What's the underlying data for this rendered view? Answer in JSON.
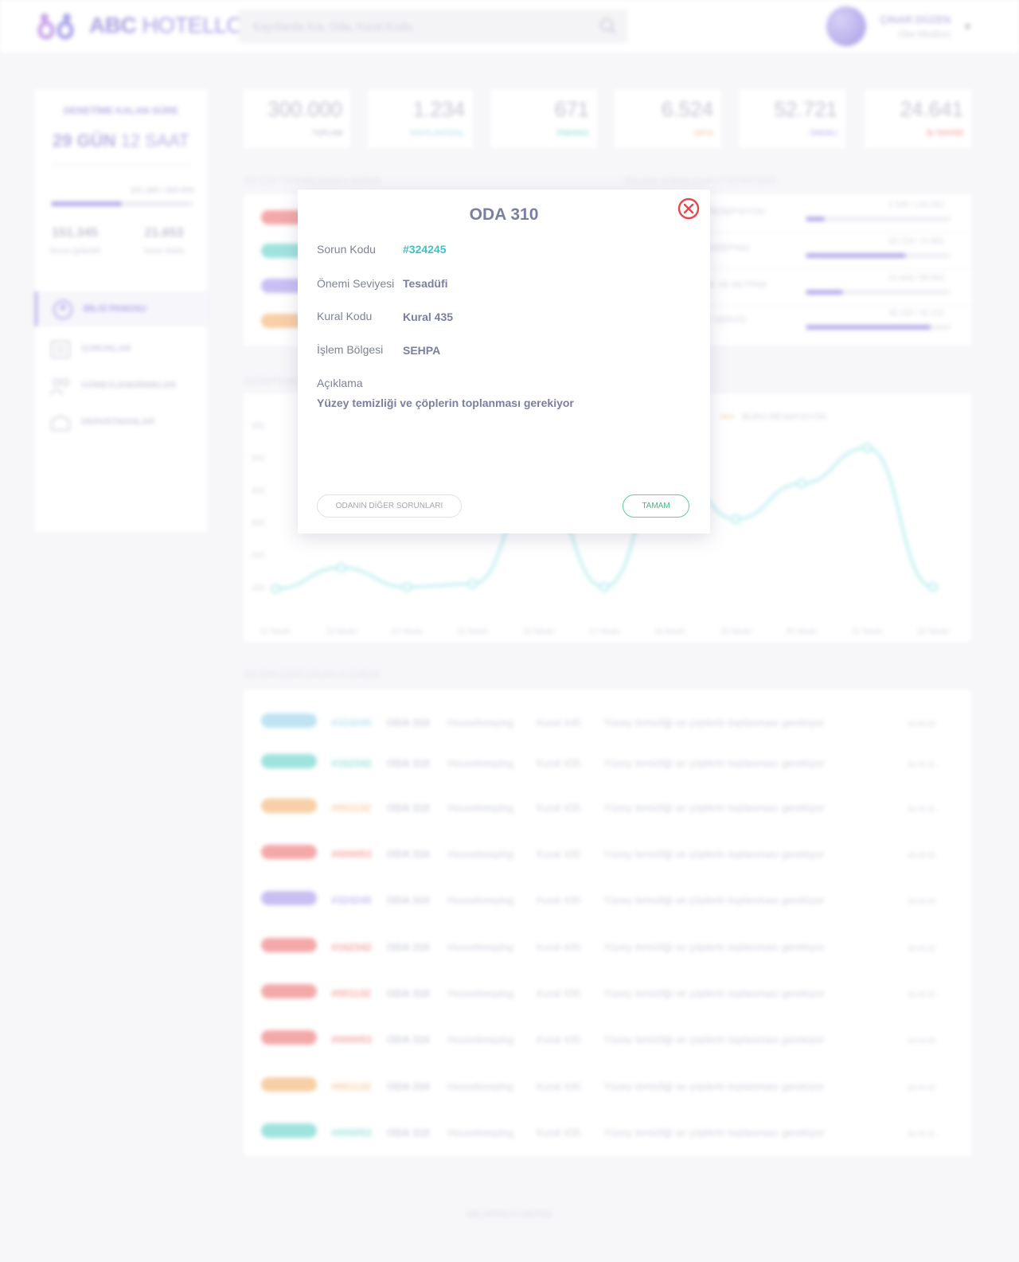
{
  "app": {
    "logo_text_bold": "ABC",
    "logo_text_light": " HOTELLO",
    "search_placeholder": "Kayıtlarda Ara, Oda, Kural Kodu",
    "user_name": "ÇINAR DÜZEN",
    "user_role": "Otel Müdürü"
  },
  "sidebar": {
    "audit_title": "DENETİME KALAN SÜRE",
    "audit_days": "29 GÜN",
    "audit_hours": " 12 SAAT",
    "progress_ratio": "151.345 / 300.000",
    "progress_fraction": 0.5,
    "stats": [
      {
        "value": "151.345",
        "label": "Sorun giderildi"
      },
      {
        "value": "21.653",
        "label": "Günü doldu"
      }
    ],
    "nav": [
      {
        "label": "BİLGİ PANOSU",
        "active": true,
        "icon": "dashboard-icon"
      },
      {
        "label": "SORUNLAR",
        "active": false,
        "icon": "issues-icon"
      },
      {
        "label": "GÖREVLENDİRMELER",
        "active": false,
        "icon": "assignments-icon"
      },
      {
        "label": "DEPARTMANLAR",
        "active": false,
        "icon": "departments-icon"
      }
    ]
  },
  "stat_cards": [
    {
      "value": "300.000",
      "label": "TOPLAM",
      "color": "#c9c9d6"
    },
    {
      "value": "1.234",
      "label": "RASTLANTISAL",
      "color": "#bfe3f2"
    },
    {
      "value": "671",
      "label": "ÖNEMSİZ",
      "color": "#9fe3de"
    },
    {
      "value": "6.524",
      "label": "ORTA",
      "color": "#f8cfa6"
    },
    {
      "value": "52.721",
      "label": "ÖNEMLİ",
      "color": "#c9bff2"
    },
    {
      "value": "24.641",
      "label": "İŞ TEHTİDİ",
      "color": "#f4a9a9"
    }
  ],
  "sections": {
    "top_left_title": "EN ÇOK TEKRARLANAN 5 SORUN",
    "top_right_title": "EN ÇOK SORUN OLAN 4 DEPARTMAN",
    "chart_title": "DEPARTMAN",
    "issues_title": "EN SON GÜNÜ DOLAN 10 SORUN"
  },
  "top_issue_chips": [
    "#f4a9a9",
    "#9fe3de",
    "#c9bff2",
    "#f8cfa6"
  ],
  "departments": [
    {
      "name": "BÜRO RESEPSİYON",
      "ratio": "1.345 / 133.562",
      "fraction": 0.13
    },
    {
      "name": "HOUSEKEEPING",
      "ratio": "53.724 / 74.952",
      "fraction": 0.69
    },
    {
      "name": "MUTFAK VE MUTFAK",
      "ratio": "21.643 / 50.562",
      "fraction": 0.26
    },
    {
      "name": "TEKNİK SERVİS",
      "ratio": "30.231 / 32.212",
      "fraction": 0.86
    }
  ],
  "chart_data": {
    "type": "line",
    "legend": [
      "BÜRO RESEPSİYON"
    ],
    "categories": [
      "12 Nisan",
      "13 Nisan",
      "14 Nisan",
      "15 Nisan",
      "16 Nisan",
      "17 Nisan",
      "18 Nisan",
      "19 Nisan",
      "20 Nisan",
      "21 Nisan",
      "22 Nisan"
    ],
    "y_ticks": [
      "100",
      "200",
      "300",
      "400",
      "500",
      "600"
    ],
    "ylim": [
      0,
      600
    ],
    "series": [
      {
        "name": "BÜRO RESEPSİYON",
        "color": "#aee9ec",
        "values": [
          95,
          160,
          100,
          110,
          430,
          100,
          490,
          310,
          420,
          530,
          100
        ]
      }
    ]
  },
  "issues": [
    {
      "chip": "#bfe3f2",
      "code": "#324245",
      "room": "ODA 310",
      "dept": "Housekeeping",
      "rule": "Kural 435",
      "desc": "Yüzey temizliği ve çöplerin  toplanması gerekiyor",
      "date": "16.04.20"
    },
    {
      "chip": "#9fe3de",
      "code": "#162342",
      "room": "ODA 310",
      "dept": "Housekeeping",
      "rule": "Kural 435",
      "desc": "Yüzey temizliği ve çöplerin  toplanması gerekiyor",
      "date": "16.04.20"
    },
    {
      "chip": "#f8cfa6",
      "code": "#001132",
      "room": "ODA 310",
      "dept": "Housekeeping",
      "rule": "Kural 435",
      "desc": "Yüzey temizliği ve çöplerin  toplanması gerekiyor",
      "date": "16.04.20"
    },
    {
      "chip": "#f4a9a9",
      "code": "#000053",
      "room": "ODA 310",
      "dept": "Housekeeping",
      "rule": "Kural 435",
      "desc": "Yüzey temizliği ve çöplerin  toplanması gerekiyor",
      "date": "16.04.20"
    },
    {
      "chip": "#c9bff2",
      "code": "#324245",
      "room": "ODA 310",
      "dept": "Housekeeping",
      "rule": "Kural 435",
      "desc": "Yüzey temizliği ve çöplerin  toplanması gerekiyor",
      "date": "16.04.20"
    },
    {
      "chip": "#f4a9a9",
      "code": "#162342",
      "room": "ODA 310",
      "dept": "Housekeeping",
      "rule": "Kural 435",
      "desc": "Yüzey temizliği ve çöplerin  toplanması gerekiyor",
      "date": "16.04.20"
    },
    {
      "chip": "#f4a9a9",
      "code": "#001132",
      "room": "ODA 310",
      "dept": "Housekeeping",
      "rule": "Kural 435",
      "desc": "Yüzey temizliği ve çöplerin  toplanması gerekiyor",
      "date": "16.04.20"
    },
    {
      "chip": "#f4a9a9",
      "code": "#000053",
      "room": "ODA 310",
      "dept": "Housekeeping",
      "rule": "Kural 435",
      "desc": "Yüzey temizliği ve çöplerin  toplanması gerekiyor",
      "date": "16.04.20"
    },
    {
      "chip": "#f8cfa6",
      "code": "#001132",
      "room": "ODA 310",
      "dept": "Housekeeping",
      "rule": "Kural 435",
      "desc": "Yüzey temizliği ve çöplerin  toplanması gerekiyor",
      "date": "16.04.20"
    },
    {
      "chip": "#9fe3de",
      "code": "#000053",
      "room": "ODA 310",
      "dept": "Housekeeping",
      "rule": "Kural 435",
      "desc": "Yüzey temizliği ve çöplerin  toplanması gerekiyor",
      "date": "16.04.20"
    }
  ],
  "footer": {
    "text": "ABC HOTELLO   |   DESTEK"
  },
  "modal": {
    "title": "ODA 310",
    "fields": [
      {
        "label": "Sorun Kodu",
        "value": "#324245"
      },
      {
        "label": "Önemi Seviyesi",
        "value": "Tesadüfi"
      },
      {
        "label": "Kural Kodu",
        "value": "Kural 435"
      },
      {
        "label": "İşlem Bölgesi",
        "value": "SEHPA"
      }
    ],
    "description_label": "Açıklama",
    "description": "Yüzey temizliği ve çöplerin  toplanması gerekiyor",
    "other_issues_button": "ODANIN DİĞER SORUNLARI",
    "ok_button": "TAMAM",
    "close_icon": "close-icon",
    "code_color": "#3cc2cc",
    "close_color": "#e5484d",
    "ok_color": "#3fba7c"
  }
}
